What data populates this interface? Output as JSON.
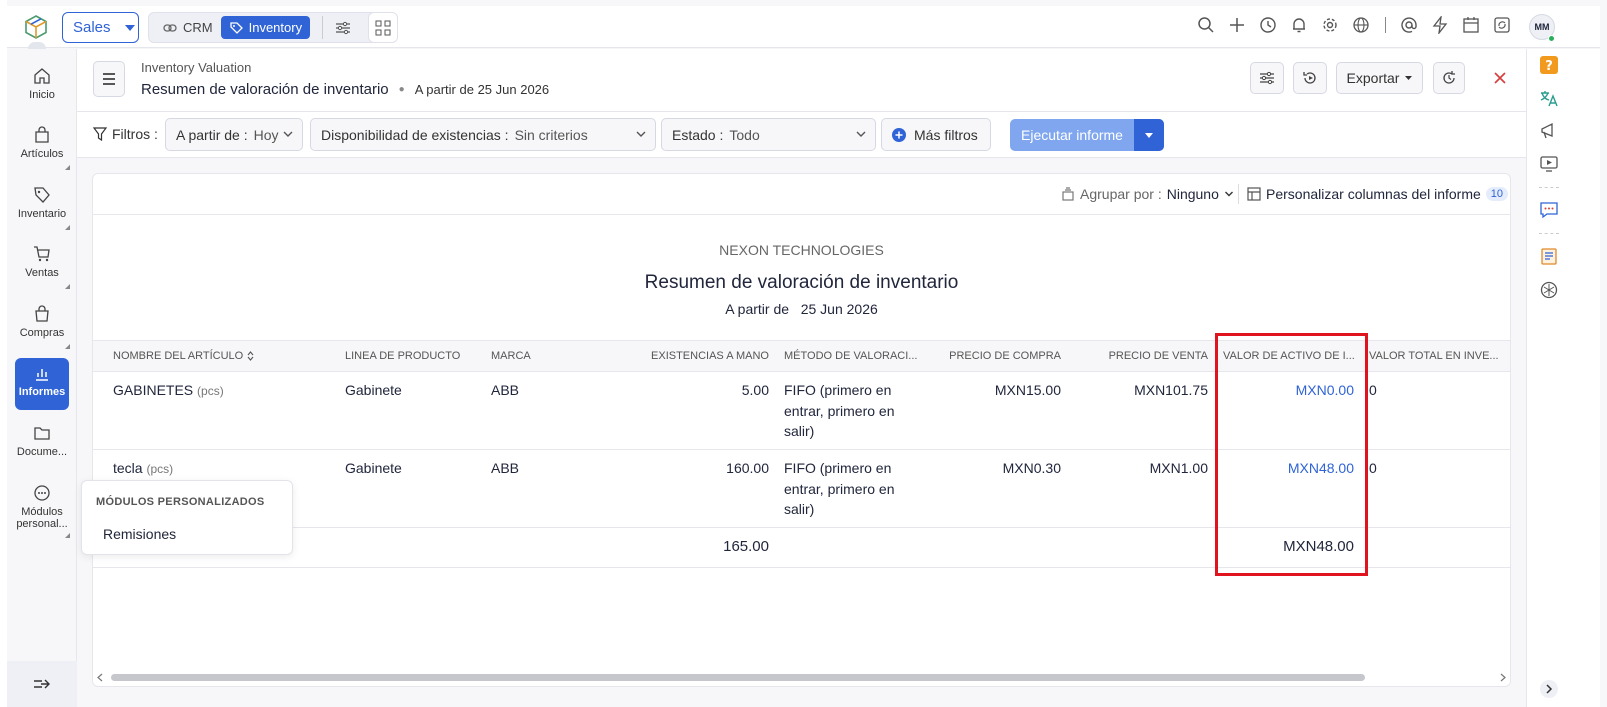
{
  "topbar": {
    "module_selector": "Sales",
    "apps": [
      {
        "label": "CRM"
      },
      {
        "label": "Inventory"
      }
    ],
    "avatar_initials": "MM"
  },
  "sidebar": {
    "items": [
      {
        "label": "Inicio",
        "icon": "home-icon"
      },
      {
        "label": "Artículos",
        "icon": "items-icon"
      },
      {
        "label": "Inventario",
        "icon": "inventory-icon"
      },
      {
        "label": "Ventas",
        "icon": "cart-icon"
      },
      {
        "label": "Compras",
        "icon": "bag-icon"
      },
      {
        "label": "Informes",
        "icon": "chart-icon",
        "active": true
      },
      {
        "label": "Docume...",
        "icon": "folder-icon"
      },
      {
        "label": "Módulos personal...",
        "icon": "more-icon"
      }
    ]
  },
  "header": {
    "breadcrumb": "Inventory Valuation",
    "title": "Resumen de valoración de inventario",
    "as_of": "A partir de 25 Jun 2026",
    "export_label": "Exportar"
  },
  "filters": {
    "label": "Filtros :",
    "as_of": {
      "label": "A partir de :",
      "value": "Hoy"
    },
    "availability": {
      "label": "Disponibilidad de existencias :",
      "value": "Sin criterios"
    },
    "status": {
      "label": "Estado :",
      "value": "Todo"
    },
    "more_filters": "Más filtros",
    "run_report": "Ejecutar informe"
  },
  "report": {
    "group_by_label": "Agrupar por :",
    "group_by_value": "Ninguno",
    "customize_label": "Personalizar columnas del informe",
    "customize_count": "10",
    "company": "NEXON TECHNOLOGIES",
    "title": "Resumen de valoración de inventario",
    "date_label": "A partir de",
    "date_value": "25 Jun 2026",
    "columns": [
      "NOMBRE DEL ARTÍCULO",
      "LINEA DE PRODUCTO",
      "MARCA",
      "EXISTENCIAS A MANO",
      "MÉTODO DE VALORACI...",
      "PRECIO DE COMPRA",
      "PRECIO DE VENTA",
      "VALOR DE ACTIVO DE I...",
      "VALOR TOTAL EN INVE..."
    ],
    "rows": [
      {
        "name": "GABINETES",
        "unit": "(pcs)",
        "product_line": "Gabinete",
        "brand": "ABB",
        "stock": "5.00",
        "method": [
          "FIFO (primero en",
          "entrar, primero en",
          "salir)"
        ],
        "purchase_price": "MXN15.00",
        "sale_price": "MXN101.75",
        "asset_value": "MXN0.00",
        "total_value": "0"
      },
      {
        "name": "tecla",
        "unit": "(pcs)",
        "product_line": "Gabinete",
        "brand": "ABB",
        "stock": "160.00",
        "method": [
          "FIFO (primero en",
          "entrar, primero en",
          "salir)"
        ],
        "purchase_price": "MXN0.30",
        "sale_price": "MXN1.00",
        "asset_value": "MXN48.00",
        "total_value": "0"
      }
    ],
    "totals": {
      "stock": "165.00",
      "asset_value": "MXN48.00"
    }
  },
  "custom_modules_popup": {
    "heading": "MÓDULOS PERSONALIZADOS",
    "items": [
      "Remisiones"
    ]
  },
  "colors": {
    "accent": "#2f63d6",
    "highlight": "#e0141e"
  }
}
